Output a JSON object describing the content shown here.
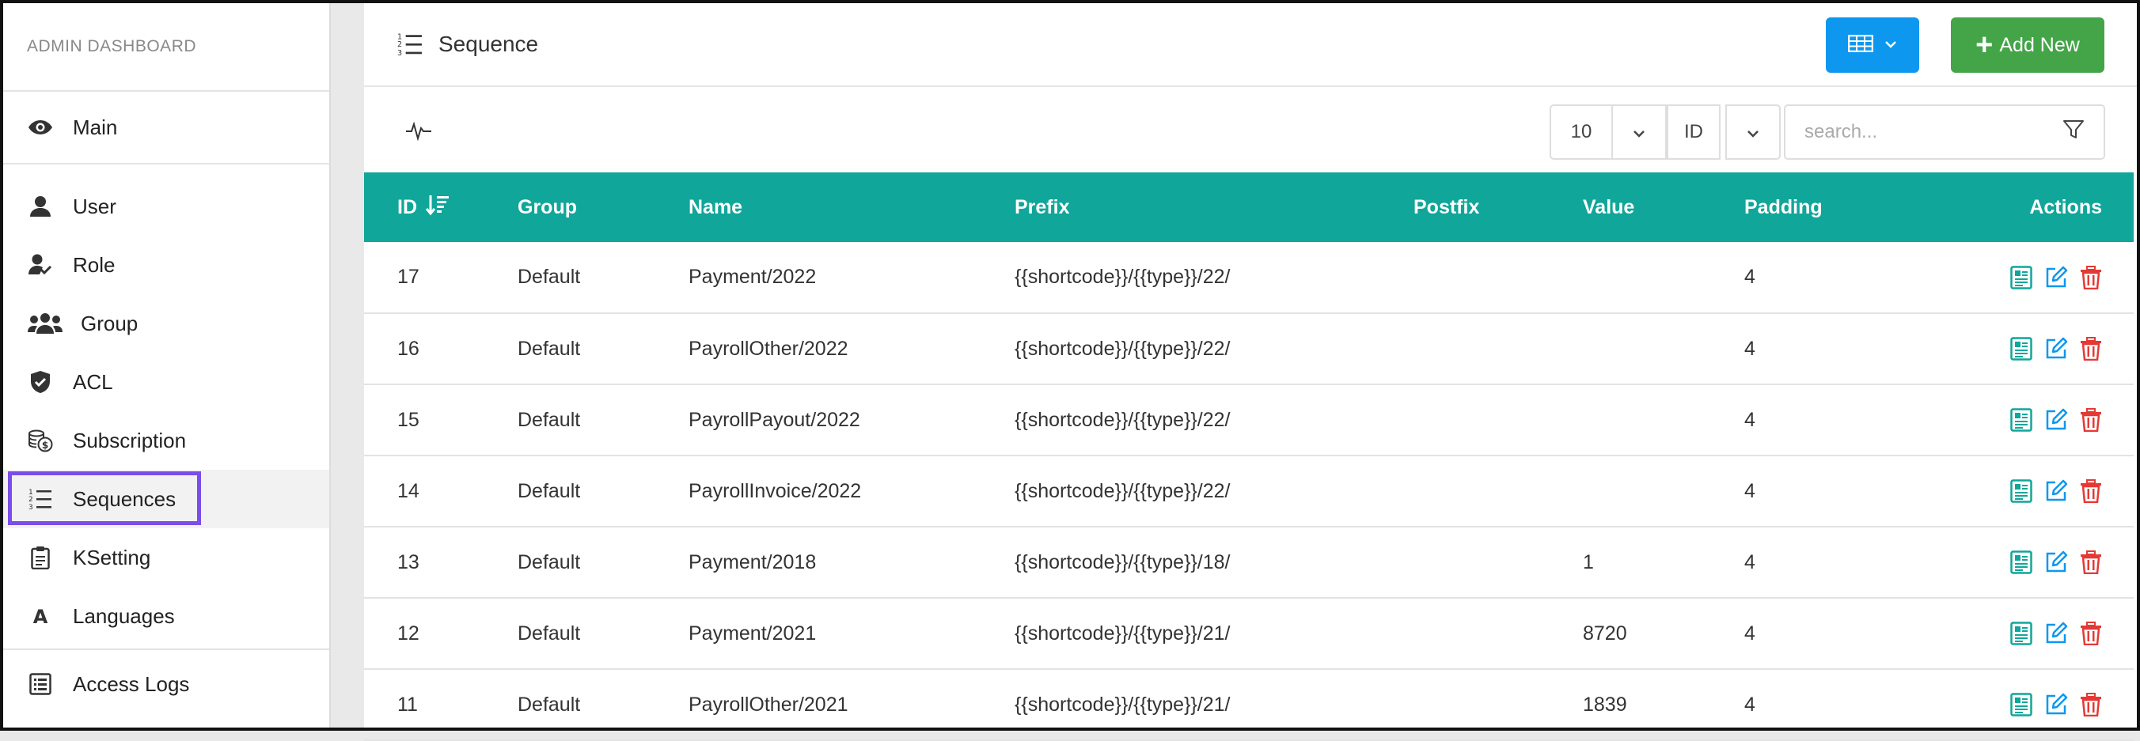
{
  "sidebar": {
    "brand": "ADMIN DASHBOARD",
    "items": [
      {
        "label": "Main",
        "icon": "eye-icon"
      },
      {
        "label": "User",
        "icon": "user-icon"
      },
      {
        "label": "Role",
        "icon": "user-check-icon"
      },
      {
        "label": "Group",
        "icon": "users-icon"
      },
      {
        "label": "ACL",
        "icon": "shield-check-icon"
      },
      {
        "label": "Subscription",
        "icon": "coins-icon"
      },
      {
        "label": "Sequences",
        "icon": "numbered-list-icon",
        "active": true
      },
      {
        "label": "KSetting",
        "icon": "clipboard-icon"
      },
      {
        "label": "Languages",
        "icon": "letter-a-icon"
      },
      {
        "label": "Access Logs",
        "icon": "list-box-icon"
      }
    ]
  },
  "header": {
    "title": "Sequence",
    "add_label": "Add New"
  },
  "toolbar": {
    "page_size": "10",
    "sort_field": "ID",
    "search_placeholder": "search..."
  },
  "table": {
    "columns": [
      "ID",
      "Group",
      "Name",
      "Prefix",
      "Postfix",
      "Value",
      "Padding",
      "Actions"
    ],
    "rows": [
      {
        "id": "17",
        "group": "Default",
        "name": "Payment/2022",
        "prefix": "{{shortcode}}/{{type}}/22/",
        "postfix": "",
        "value": "",
        "padding": "4"
      },
      {
        "id": "16",
        "group": "Default",
        "name": "PayrollOther/2022",
        "prefix": "{{shortcode}}/{{type}}/22/",
        "postfix": "",
        "value": "",
        "padding": "4"
      },
      {
        "id": "15",
        "group": "Default",
        "name": "PayrollPayout/2022",
        "prefix": "{{shortcode}}/{{type}}/22/",
        "postfix": "",
        "value": "",
        "padding": "4"
      },
      {
        "id": "14",
        "group": "Default",
        "name": "PayrollInvoice/2022",
        "prefix": "{{shortcode}}/{{type}}/22/",
        "postfix": "",
        "value": "",
        "padding": "4"
      },
      {
        "id": "13",
        "group": "Default",
        "name": "Payment/2018",
        "prefix": "{{shortcode}}/{{type}}/18/",
        "postfix": "",
        "value": "1",
        "padding": "4"
      },
      {
        "id": "12",
        "group": "Default",
        "name": "Payment/2021",
        "prefix": "{{shortcode}}/{{type}}/21/",
        "postfix": "",
        "value": "8720",
        "padding": "4"
      },
      {
        "id": "11",
        "group": "Default",
        "name": "PayrollOther/2021",
        "prefix": "{{shortcode}}/{{type}}/21/",
        "postfix": "",
        "value": "1839",
        "padding": "4"
      }
    ]
  },
  "colors": {
    "header_teal": "#10a69a",
    "view_blue": "#0d97ef",
    "add_green": "#43a548",
    "active_outline": "#7b4dea",
    "delete_red": "#e53935"
  }
}
